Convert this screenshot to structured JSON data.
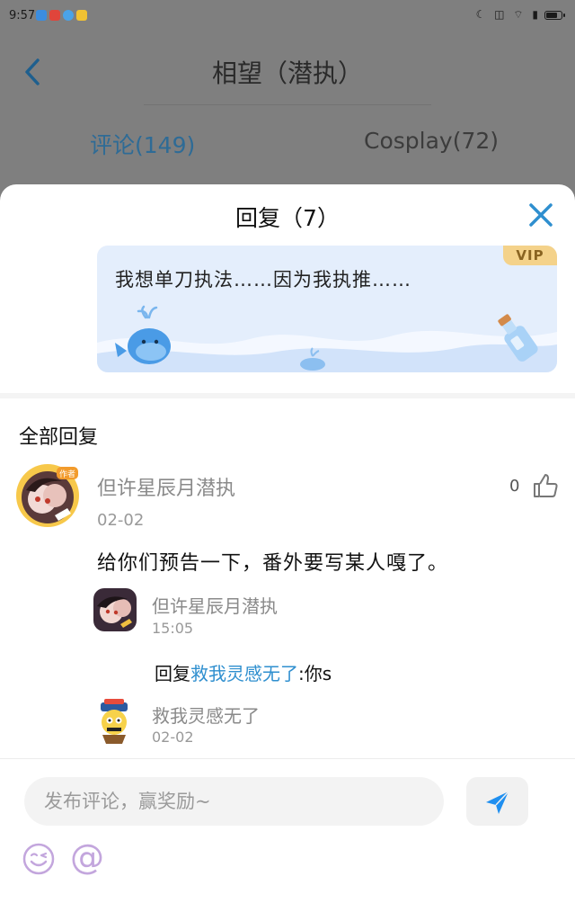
{
  "status_bar": {
    "time": "9:57",
    "right_icons": "☾ ◫ ⌔ ▮",
    "battery_level": 0.8
  },
  "header": {
    "back_icon": "chevron-left-icon",
    "title": "相望（潜执）"
  },
  "tabs": [
    {
      "label": "评论(149)",
      "active": true
    },
    {
      "label": "Cosplay(72)",
      "active": false
    }
  ],
  "sheet": {
    "title": "回复（7）",
    "close_icon": "close-icon",
    "original_comment": {
      "text": "我想单刀执法……因为我执推……",
      "badge": "VIP"
    },
    "section_title": "全部回复",
    "comment": {
      "author": "但许星辰月潜执",
      "avatar_badge": "作者",
      "date": "02-02",
      "text": "给你们预告一下，番外要写某人嘎了。",
      "like_count": "0",
      "replies": [
        {
          "author": "但许星辰月潜执",
          "time": "15:05",
          "prefix": "回复",
          "target": "救我灵感无了",
          "text": ":你s"
        },
        {
          "author": "救我灵感无了",
          "time": "02-02"
        }
      ]
    }
  },
  "input": {
    "placeholder": "发布评论，赢奖励~",
    "send_icon": "send-icon",
    "emoji_icon": "emoji-icon",
    "at_label": "@"
  },
  "colors": {
    "accent": "#2f8fcf",
    "overlay": "#7f7f7f",
    "card_bg": "#e4eefc",
    "vip": "#f4d28a"
  }
}
